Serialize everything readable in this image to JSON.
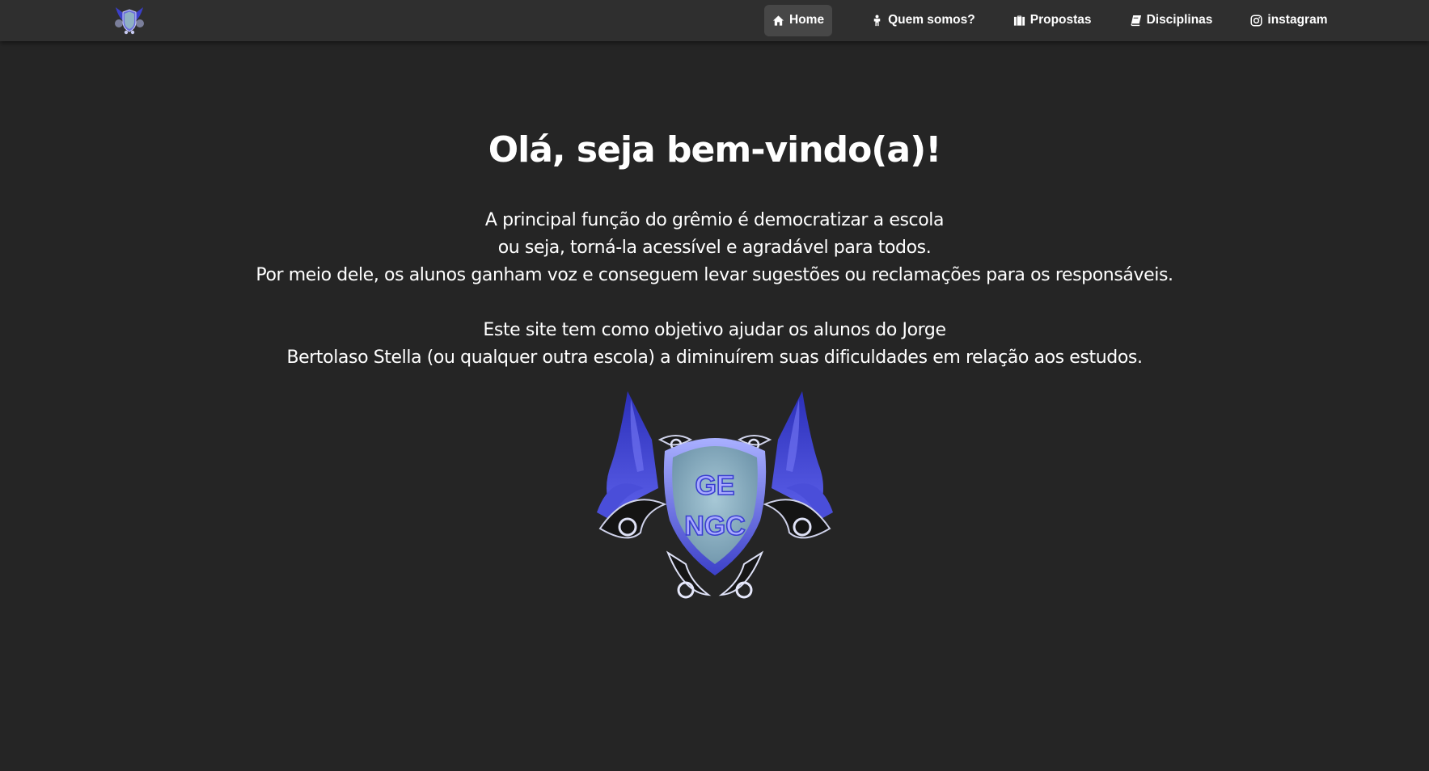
{
  "nav": {
    "logo_icon": "gengc-emblem-logo",
    "items": [
      {
        "label": "Home",
        "icon": "home-icon",
        "active": true
      },
      {
        "label": "Quem somos?",
        "icon": "person-icon",
        "active": false
      },
      {
        "label": "Propostas",
        "icon": "briefcase-icon",
        "active": false
      },
      {
        "label": "Disciplinas",
        "icon": "book-icon",
        "active": false
      },
      {
        "label": "instagram",
        "icon": "instagram-icon",
        "active": false
      }
    ]
  },
  "main": {
    "title": "Olá, seja bem-vindo(a)!",
    "paragraph1": [
      "A principal função do grêmio é democratizar a escola",
      "ou seja, torná-la acessível e agradável para todos.",
      "Por meio dele, os alunos ganham voz e conseguem levar sugestões ou reclamações para os responsáveis."
    ],
    "paragraph2": [
      "Este site tem como objetivo ajudar os alunos do Jorge",
      "Bertolaso Stella (ou qualquer outra escola) a diminuírem suas dificuldades em relação aos estudos."
    ],
    "emblem": {
      "line1": "GE",
      "line2": "NGC"
    }
  },
  "colors": {
    "background": "#252525",
    "navbar": "#2f2f2f",
    "active_nav": "#474747",
    "emblem_blue": "#3a3fd0",
    "emblem_shield": "#8fb1c3"
  }
}
